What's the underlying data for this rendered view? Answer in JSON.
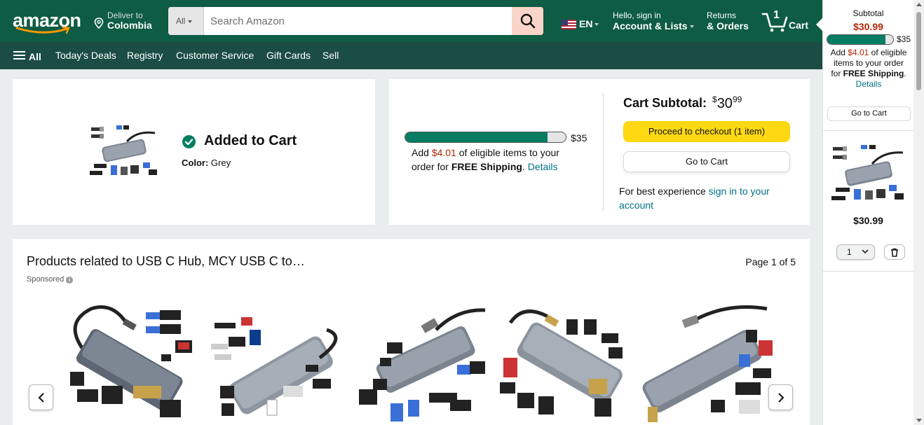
{
  "header": {
    "logo_text": "amazon",
    "deliver_line1": "Deliver to",
    "deliver_line2": "Colombia",
    "search_category": "All",
    "search_placeholder": "Search Amazon",
    "language": "EN",
    "account_line1": "Hello, sign in",
    "account_line2": "Account & Lists",
    "returns_line1": "Returns",
    "returns_line2": "& Orders",
    "cart_count": "1",
    "cart_label": "Cart",
    "colors": {
      "topbar": "#0d5c43",
      "navbar": "#1b4d44",
      "search_button": "#f8d5c8"
    }
  },
  "nav": {
    "all": "All",
    "items": [
      "Today's Deals",
      "Registry",
      "Customer Service",
      "Gift Cards",
      "Sell"
    ]
  },
  "added": {
    "title": "Added to Cart",
    "color_label": "Color:",
    "color_value": "Grey"
  },
  "subtotal": {
    "progress_fraction": 0.885,
    "threshold": "$35",
    "msg_prefix": "Add ",
    "msg_amount": "$4.01",
    "msg_middle": " of eligible items to your order for ",
    "msg_bold": "FREE Shipping",
    "msg_period": ". ",
    "details": "Details",
    "cart_subtotal_label": "Cart Subtotal:",
    "price_symbol": "$",
    "price_whole": "30",
    "price_fraction": "99",
    "checkout_button": "Proceed to checkout (1 item)",
    "go_to_cart_button": "Go to Cart",
    "best_prefix": "For best experience ",
    "best_link": "sign in to your account"
  },
  "related": {
    "title": "Products related to USB C Hub, MCY USB C to…",
    "page": "Page 1 of 5",
    "sponsored": "Sponsored"
  },
  "panel": {
    "subtotal_label": "Subtotal",
    "subtotal_value": "$30.99",
    "progress_fraction": 0.885,
    "threshold": "$35",
    "msg_prefix": "Add ",
    "msg_amount": "$4.01",
    "msg_middle": " of eligible items to your order for ",
    "msg_bold": "FREE Shipping",
    "msg_period": ".",
    "details": "Details",
    "go_to_cart": "Go to Cart",
    "item_price": "$30.99",
    "quantity": "1"
  }
}
